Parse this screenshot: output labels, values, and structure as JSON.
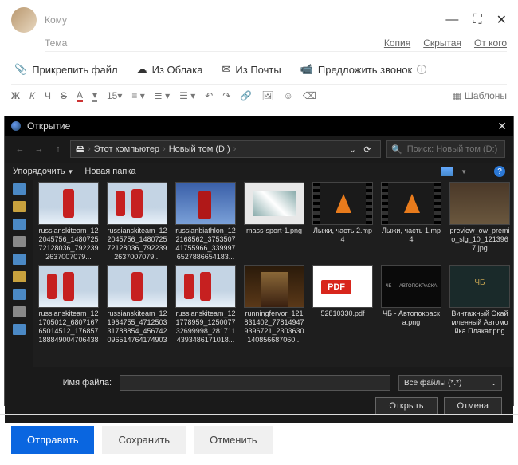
{
  "compose": {
    "to_label": "Кому",
    "subject_label": "Тема",
    "links": {
      "copy": "Копия",
      "hidden": "Скрытая",
      "from": "От кого"
    },
    "attach": {
      "file": "Прикрепить файл",
      "cloud": "Из Облака",
      "mail": "Из Почты",
      "call": "Предложить звонок"
    },
    "fmt": {
      "bold": "Ж",
      "italic": "К",
      "underline": "Ч",
      "strike": "S",
      "font_a": "A",
      "bg_a": "A",
      "size": "15"
    },
    "templates": "Шаблоны"
  },
  "dialog": {
    "title": "Открытие",
    "crumbs": {
      "pc": "Этот компьютер",
      "drive": "Новый том (D:)"
    },
    "search_placeholder": "Поиск: Новый том (D:)",
    "toolbar": {
      "organize": "Упорядочить",
      "newfolder": "Новая папка"
    },
    "files_row1": [
      {
        "name": "russianskiteam_122045756_148072572128036_7922392637007079...",
        "cls": "ski"
      },
      {
        "name": "russianskiteam_122045756_148072572128036_7922392637007079...",
        "cls": "ski ski2"
      },
      {
        "name": "russianbiathlon_122168562_375350741755966_3399976527886654183...",
        "cls": "bi"
      },
      {
        "name": "mass-sport-1.png",
        "cls": "ms"
      },
      {
        "name": "Лыжи, часть 2.mp4",
        "cls": "vid"
      },
      {
        "name": "Лыжи, часть 1.mp4",
        "cls": "vid"
      },
      {
        "name": "preview_ow_premio_slg_10_1213967.jpg",
        "cls": "room"
      }
    ],
    "files_row2": [
      {
        "name": "russianskiteam_121705012_680716765014512_1768571888490047064383...",
        "cls": "ski ski2"
      },
      {
        "name": "russianskiteam_121964755_471250331788854_4567420965147641749036...",
        "cls": "ski"
      },
      {
        "name": "russianskiteam_121778959_125007732699998_2817114393486171018...",
        "cls": "ski ski2"
      },
      {
        "name": "runningfervor_121831402_778149479396721_2303630140856687060...",
        "cls": "run"
      },
      {
        "name": "52810330.pdf",
        "cls": "pdf"
      },
      {
        "name": "ЧБ - Автопокраска.png",
        "cls": "dark"
      },
      {
        "name": "Винтажный Окаймленный Автомойка Плакат.png",
        "cls": "poster"
      }
    ],
    "filename_label": "Имя файла:",
    "filetype": "Все файлы (*.*)",
    "open": "Открыть",
    "cancel": "Отмена"
  },
  "bottom": {
    "send": "Отправить",
    "save": "Сохранить",
    "cancel": "Отменить"
  },
  "dark_txt": "ЧБ — АВТОПОКРАСКА"
}
